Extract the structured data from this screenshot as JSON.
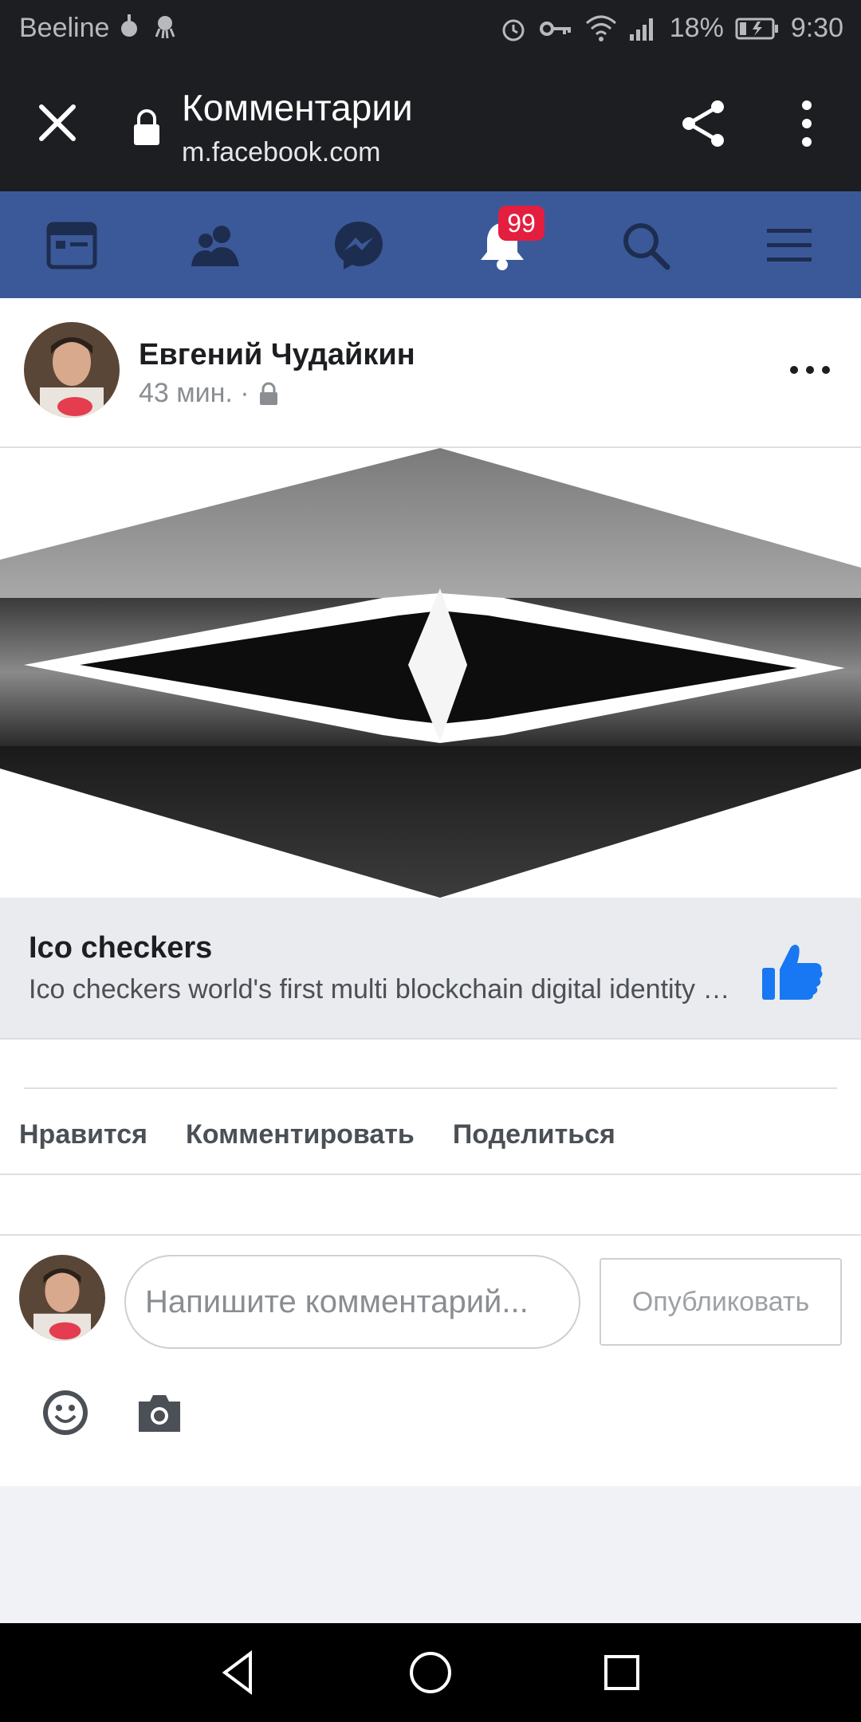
{
  "status_bar": {
    "carrier": "Beeline",
    "battery": "18%",
    "time": "9:30"
  },
  "browser": {
    "title": "Комментарии",
    "url": "m.facebook.com",
    "icons": [
      "close-icon",
      "lock-icon",
      "share-icon",
      "more-vert-icon"
    ]
  },
  "fb_nav": {
    "items": [
      "news-feed-icon",
      "friends-icon",
      "messenger-icon",
      "notifications-icon",
      "search-icon",
      "menu-icon"
    ],
    "notification_badge": "99",
    "accent": "#3b5998"
  },
  "post": {
    "author": "Евгений Чудайкин",
    "timestamp": "43 мин. ·"
  },
  "link_preview": {
    "title": "Ico checkers",
    "description": "Ico checkers world's first multi blockchain digital identity platform",
    "like_color": "#1877f2"
  },
  "actions": {
    "like": "Нравится",
    "comment": "Комментировать",
    "share": "Поделиться"
  },
  "comment_box": {
    "placeholder": "Напишите комментарий...",
    "publish": "Опубликовать"
  }
}
